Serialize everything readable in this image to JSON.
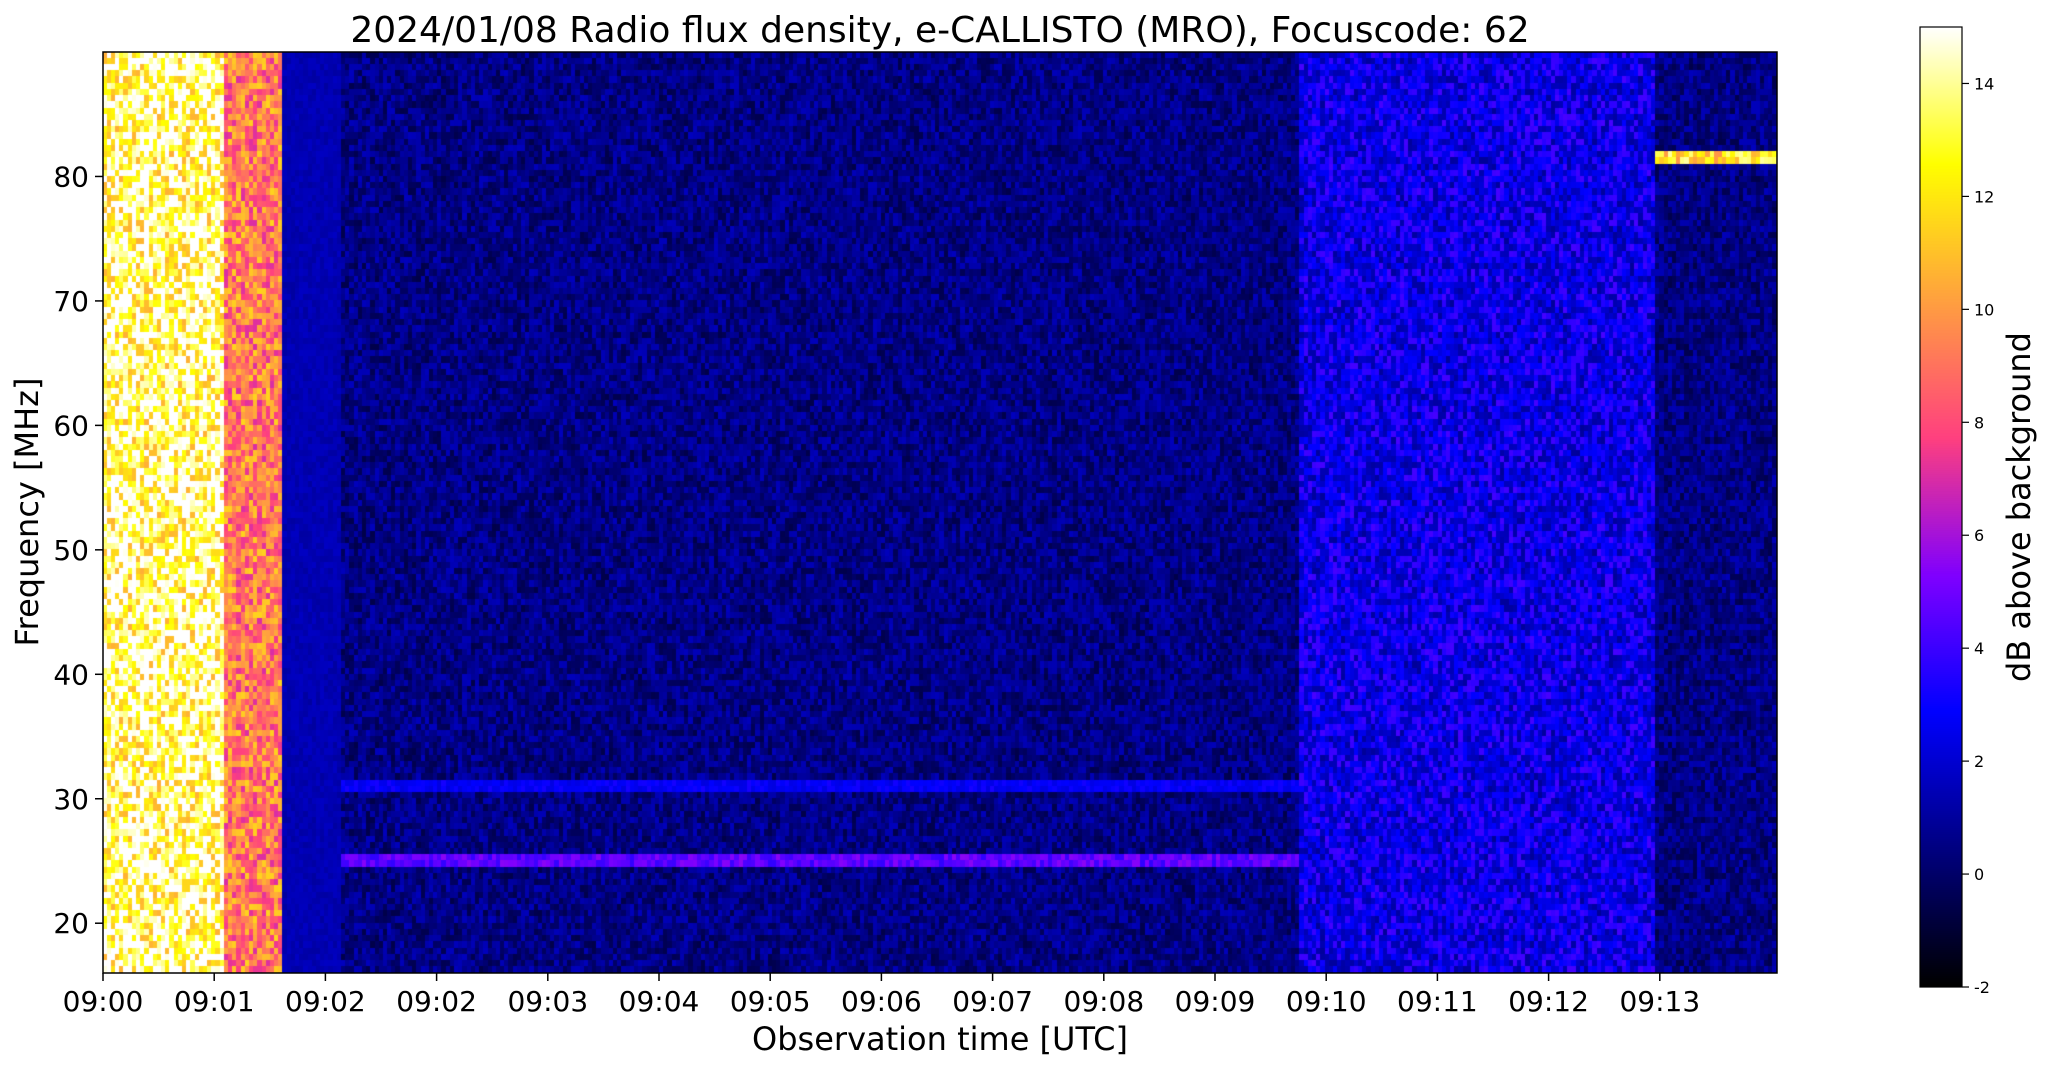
{
  "chart_data": {
    "type": "heatmap",
    "title": "2024/01/08  Radio flux density, e-CALLISTO (MRO), Focuscode: 62",
    "xlabel": "Observation time [UTC]",
    "ylabel": "Frequency [MHz]",
    "x_tick_labels": [
      "09:00",
      "09:01",
      "09:02",
      "09:02",
      "09:03",
      "09:04",
      "09:05",
      "09:06",
      "09:07",
      "09:08",
      "09:09",
      "09:10",
      "09:11",
      "09:12",
      "09:13"
    ],
    "y_ticks": [
      20,
      30,
      40,
      50,
      60,
      70,
      80
    ],
    "ylim": [
      16,
      90
    ],
    "colorbar": {
      "label": "dB above background",
      "ticks": [
        -2,
        0,
        2,
        4,
        6,
        8,
        10,
        12,
        14
      ],
      "range": [
        -2,
        15
      ],
      "colormap": "gnuplot2",
      "stops": [
        "#000000",
        "#000080",
        "#0000ff",
        "#8000ff",
        "#ff4080",
        "#ffa040",
        "#ffff00",
        "#ffffff"
      ]
    },
    "background_level_db": 0.5,
    "features": [
      {
        "kind": "saturated_calibration_block",
        "time": [
          "09:00",
          "09:01"
        ],
        "freq_mhz": [
          16,
          90
        ],
        "level_db": 15
      },
      {
        "kind": "strong_calibration_block",
        "time": [
          "09:01",
          "09:01"
        ],
        "freq_mhz": [
          16,
          90
        ],
        "level_db": 10
      },
      {
        "kind": "medium_calibration_block",
        "time": [
          "09:01",
          "09:02"
        ],
        "freq_mhz": [
          16,
          90
        ],
        "level_db": 1.5
      },
      {
        "kind": "broadband_interference",
        "time": [
          "09:09",
          "09:12"
        ],
        "freq_mhz": [
          16,
          90
        ],
        "level_db": 3
      },
      {
        "kind": "narrowband_rfi",
        "time": [
          "09:12",
          "09:13"
        ],
        "freq_mhz": [
          81.5,
          81.5
        ],
        "level_db": 13
      },
      {
        "kind": "narrowband_rfi",
        "time": [
          "09:02",
          "09:09"
        ],
        "freq_mhz": [
          25,
          25
        ],
        "level_db": 5
      },
      {
        "kind": "narrowband_rfi",
        "time": [
          "09:02",
          "09:09"
        ],
        "freq_mhz": [
          31,
          31
        ],
        "level_db": 3
      }
    ]
  }
}
